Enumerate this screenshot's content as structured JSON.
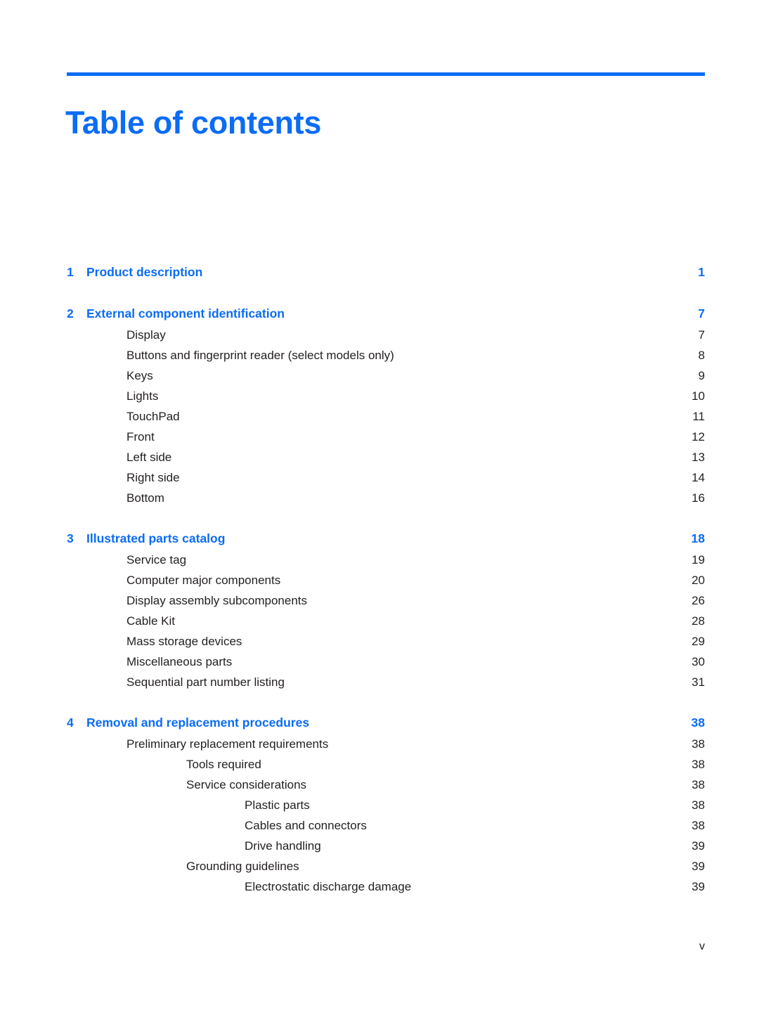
{
  "document": {
    "title": "Table of contents",
    "folio": "v",
    "accent_color": "#0b6cf5",
    "text_color": "#231f20"
  },
  "toc": {
    "entries": [
      {
        "level": 1,
        "number": "1",
        "label": "Product description",
        "page": "1",
        "space_after": true
      },
      {
        "level": 1,
        "number": "2",
        "label": "External component identification",
        "page": "7"
      },
      {
        "level": 2,
        "label": "Display",
        "page": "7"
      },
      {
        "level": 2,
        "label": "Buttons and fingerprint reader (select models only)",
        "page": "8"
      },
      {
        "level": 2,
        "label": "Keys",
        "page": "9"
      },
      {
        "level": 2,
        "label": "Lights",
        "page": "10"
      },
      {
        "level": 2,
        "label": "TouchPad",
        "page": "11"
      },
      {
        "level": 2,
        "label": "Front",
        "page": "12"
      },
      {
        "level": 2,
        "label": "Left side",
        "page": "13"
      },
      {
        "level": 2,
        "label": "Right side",
        "page": "14"
      },
      {
        "level": 2,
        "label": "Bottom",
        "page": "16",
        "space_after": true
      },
      {
        "level": 1,
        "number": "3",
        "label": "Illustrated parts catalog",
        "page": "18"
      },
      {
        "level": 2,
        "label": "Service tag",
        "page": "19"
      },
      {
        "level": 2,
        "label": "Computer major components",
        "page": "20"
      },
      {
        "level": 2,
        "label": "Display assembly subcomponents",
        "page": "26"
      },
      {
        "level": 2,
        "label": "Cable Kit",
        "page": "28"
      },
      {
        "level": 2,
        "label": "Mass storage devices",
        "page": "29"
      },
      {
        "level": 2,
        "label": "Miscellaneous parts",
        "page": "30"
      },
      {
        "level": 2,
        "label": "Sequential part number listing",
        "page": "31",
        "space_after": true
      },
      {
        "level": 1,
        "number": "4",
        "label": "Removal and replacement procedures",
        "page": "38"
      },
      {
        "level": 2,
        "label": "Preliminary replacement requirements",
        "page": "38"
      },
      {
        "level": 3,
        "label": "Tools required",
        "page": "38"
      },
      {
        "level": 3,
        "label": "Service considerations",
        "page": "38"
      },
      {
        "level": 4,
        "label": "Plastic parts",
        "page": "38"
      },
      {
        "level": 4,
        "label": "Cables and connectors",
        "page": "38"
      },
      {
        "level": 4,
        "label": "Drive handling",
        "page": "39"
      },
      {
        "level": 3,
        "label": "Grounding guidelines",
        "page": "39"
      },
      {
        "level": 4,
        "label": "Electrostatic discharge damage",
        "page": "39"
      }
    ]
  }
}
